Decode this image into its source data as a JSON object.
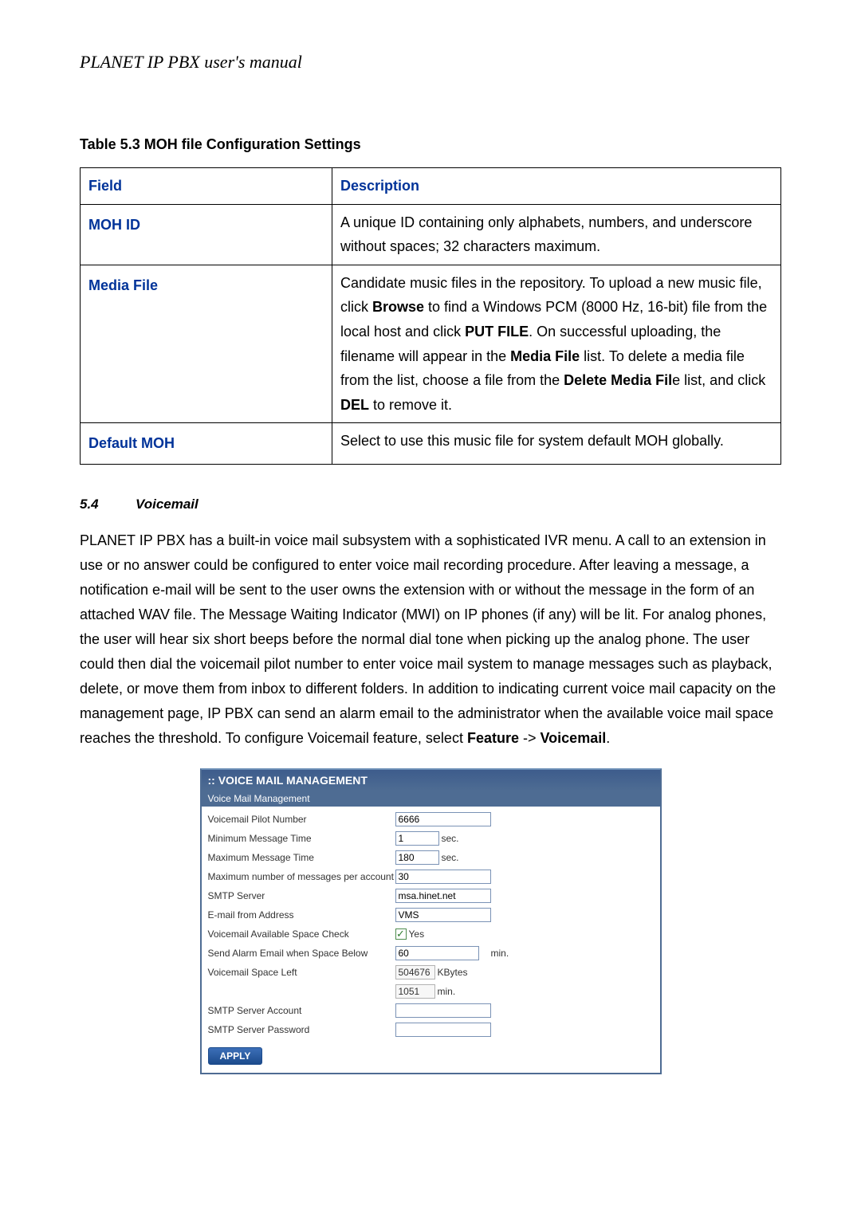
{
  "doc_title": "PLANET IP PBX user's manual",
  "table": {
    "caption": "Table 5.3 MOH file Configuration Settings",
    "head_field": "Field",
    "head_desc": "Description",
    "rows": [
      {
        "field": "MOH ID",
        "desc_pre": "A unique ID containing only alphabets, numbers, and underscore without spaces; 32 characters maximum."
      },
      {
        "field": "Media File",
        "desc_parts": {
          "a": "Candidate music files in the repository. To upload a new music file, click ",
          "b": "Browse",
          "c": " to find a Windows PCM (8000 Hz, 16-bit) file from the local host and click ",
          "d": "PUT FILE",
          "e": ". On successful uploading, the filename will appear in the ",
          "f": "Media File",
          "g": " list. To delete a media file from the list, choose a file from the ",
          "h": "Delete Media Fil",
          "i": "e list, and click ",
          "j": "DEL",
          "k": " to remove it."
        }
      },
      {
        "field": "Default MOH",
        "desc_pre": "Select to use this music file for system default MOH globally."
      }
    ]
  },
  "section": {
    "num": "5.4",
    "title": "Voicemail",
    "para_a": "PLANET IP PBX has a built-in voice mail subsystem with a sophisticated IVR menu. A call to an extension in use or no answer could be configured to enter voice mail recording procedure. After leaving a message, a notification e-mail will be sent to the user owns the extension with or without the message in the form of an attached WAV file. The Message Waiting Indicator (MWI) on IP phones (if any) will be lit. For analog phones, the user will hear six short beeps before the normal dial tone when picking up the analog phone. The user could then dial the voicemail pilot number to enter voice mail system to manage messages such as playback, delete, or move them from inbox to different folders. In addition to indicating current voice mail capacity on the management page, IP PBX can send an alarm email to the administrator when the available voice mail space reaches the threshold. To configure Voicemail feature, select ",
    "para_b": "Feature",
    "para_c": " -> ",
    "para_d": "Voicemail",
    "para_e": "."
  },
  "shot": {
    "title": ":: VOICE MAIL MANAGEMENT",
    "subtitle": "Voice Mail Management",
    "rows": {
      "pilot_lbl": "Voicemail Pilot Number",
      "pilot_val": "6666",
      "minmsg_lbl": "Minimum Message Time",
      "minmsg_val": "1",
      "maxmsg_lbl": "Maximum Message Time",
      "maxmsg_val": "180",
      "maxnum_lbl": "Maximum number of messages per account",
      "maxnum_val": "30",
      "smtp_lbl": "SMTP Server",
      "smtp_val": "msa.hinet.net",
      "from_lbl": "E-mail from Address",
      "from_val": "VMS",
      "check_lbl": "Voicemail Available Space Check",
      "check_txt": "Yes",
      "alarm_lbl": "Send Alarm Email when Space Below",
      "alarm_val": "60",
      "left_lbl": "Voicemail Space Left",
      "left_kb": "504676",
      "left_kb_u": "KBytes",
      "left_min": "1051",
      "left_min_u": "min.",
      "acct_lbl": "SMTP Server Account",
      "pass_lbl": "SMTP Server Password",
      "sec_u": "sec.",
      "min_u": "min."
    },
    "apply": "APPLY"
  }
}
